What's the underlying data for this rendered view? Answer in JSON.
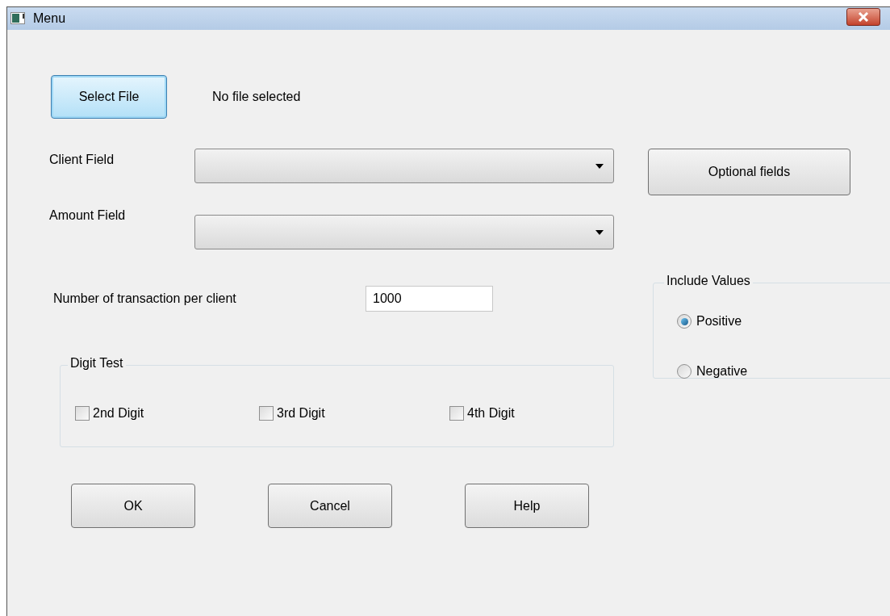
{
  "window": {
    "title": "Menu"
  },
  "file": {
    "button": "Select File",
    "focused": true,
    "status": "No file selected"
  },
  "fields": [
    {
      "label": "Client Field"
    },
    {
      "label": "Amount Field"
    }
  ],
  "optional_button": "Optional fields",
  "transactions": {
    "label": "Number of transaction per client",
    "value": "1000"
  },
  "digit_test": {
    "title": "Digit Test",
    "options": [
      {
        "label": "2nd Digit",
        "checked": false
      },
      {
        "label": "3rd Digit",
        "checked": false
      },
      {
        "label": "4th Digit",
        "checked": false
      }
    ]
  },
  "include_values": {
    "title": "Include Values",
    "options": [
      {
        "label": "Positive",
        "selected": true
      },
      {
        "label": "Negative",
        "selected": false
      }
    ]
  },
  "buttons": [
    "OK",
    "Cancel",
    "Help"
  ]
}
